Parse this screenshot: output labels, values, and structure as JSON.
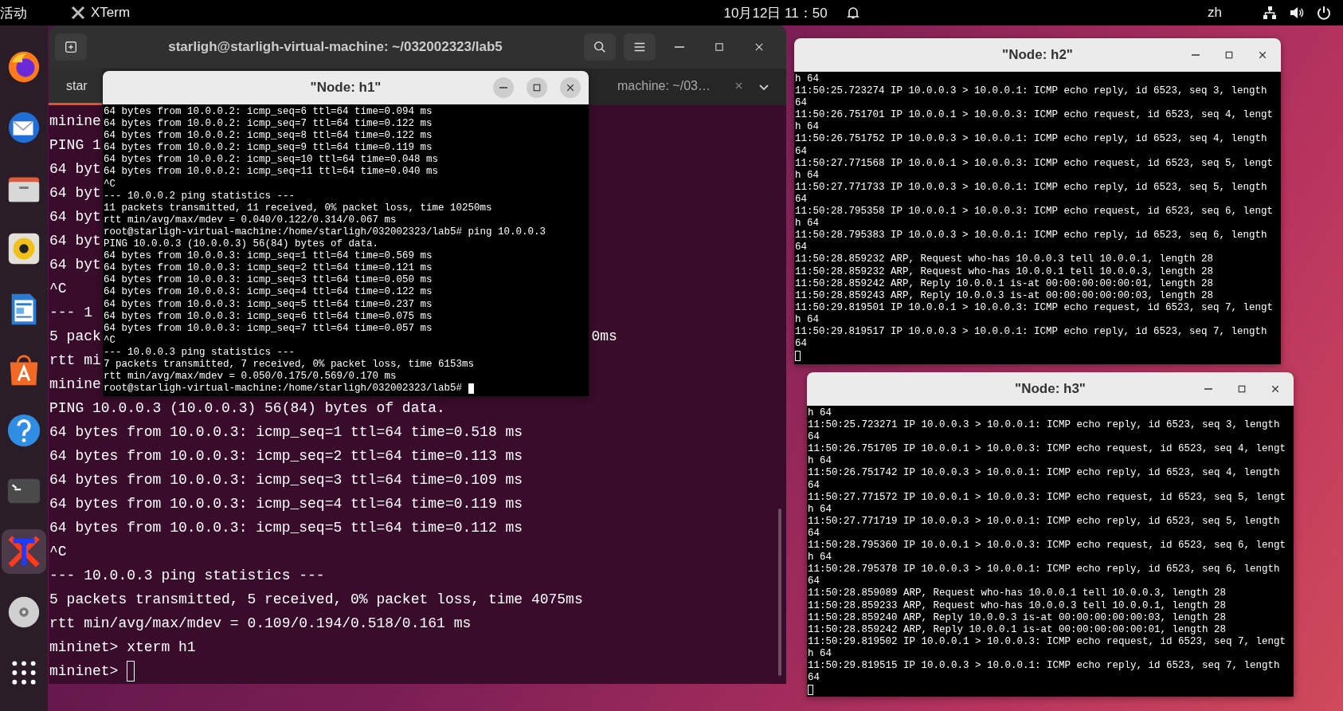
{
  "top_bar": {
    "activities": "活动",
    "app": "XTerm",
    "clock": "10月12日 11：50",
    "language": "zh"
  },
  "dock": [
    {
      "kind": "firefox",
      "selected": false
    },
    {
      "kind": "mail",
      "selected": false
    },
    {
      "kind": "files",
      "selected": false
    },
    {
      "kind": "music",
      "selected": false
    },
    {
      "kind": "writer",
      "selected": false
    },
    {
      "kind": "store",
      "selected": false
    },
    {
      "kind": "help",
      "selected": false
    },
    {
      "kind": "terminal",
      "selected": false
    },
    {
      "kind": "xterm",
      "selected": true
    },
    {
      "kind": "disc",
      "selected": false
    },
    {
      "kind": "grid",
      "selected": false
    }
  ],
  "terminal": {
    "title": "starligh@starligh-virtual-machine: ~/032002323/lab5",
    "tabs": [
      {
        "label": "star",
        "selected": true
      },
      {
        "label": "machine: ~/03…",
        "selected": false
      }
    ],
    "lines": [
      {
        "text": "minine"
      },
      {
        "text": "PING 1"
      },
      {
        "text": "64 byt"
      },
      {
        "text": "64 byt"
      },
      {
        "text": "64 byt"
      },
      {
        "text": "64 byt"
      },
      {
        "text": "64 byt"
      },
      {
        "text": "^C"
      },
      {
        "text": "--- 1"
      },
      {
        "text": "5 pack",
        "tail": "0ms"
      },
      {
        "text": "rtt mi"
      },
      {
        "text": "minine"
      },
      {
        "text": "PING 10.0.0.3 (10.0.0.3) 56(84) bytes of data."
      },
      {
        "text": "64 bytes from 10.0.0.3: icmp_seq=1 ttl=64 time=0.518 ms"
      },
      {
        "text": "64 bytes from 10.0.0.3: icmp_seq=2 ttl=64 time=0.113 ms"
      },
      {
        "text": "64 bytes from 10.0.0.3: icmp_seq=3 ttl=64 time=0.109 ms"
      },
      {
        "text": "64 bytes from 10.0.0.3: icmp_seq=4 ttl=64 time=0.119 ms"
      },
      {
        "text": "64 bytes from 10.0.0.3: icmp_seq=5 ttl=64 time=0.112 ms"
      },
      {
        "text": "^C"
      },
      {
        "text": "--- 10.0.0.3 ping statistics ---"
      },
      {
        "text": "5 packets transmitted, 5 received, 0% packet loss, time 4075ms"
      },
      {
        "text": "rtt min/avg/max/mdev = 0.109/0.194/0.518/0.161 ms"
      },
      {
        "text": "mininet> xterm h1"
      },
      {
        "text": "mininet>",
        "cursor": true
      }
    ]
  },
  "xterm_windows": [
    {
      "title": "\"Node: h1\"",
      "focused": true,
      "lines": [
        {
          "text": "64 bytes from 10.0.0.2: icmp_seq=6 ttl=64 time=0.094 ms"
        },
        {
          "text": "64 bytes from 10.0.0.2: icmp_seq=7 ttl=64 time=0.122 ms"
        },
        {
          "text": "64 bytes from 10.0.0.2: icmp_seq=8 ttl=64 time=0.122 ms"
        },
        {
          "text": "64 bytes from 10.0.0.2: icmp_seq=9 ttl=64 time=0.119 ms"
        },
        {
          "text": "64 bytes from 10.0.0.2: icmp_seq=10 ttl=64 time=0.048 ms"
        },
        {
          "text": "64 bytes from 10.0.0.2: icmp_seq=11 ttl=64 time=0.040 ms"
        },
        {
          "text": "^C"
        },
        {
          "text": "--- 10.0.0.2 ping statistics ---"
        },
        {
          "text": "11 packets transmitted, 11 received, 0% packet loss, time 10250ms"
        },
        {
          "text": "rtt min/avg/max/mdev = 0.040/0.122/0.314/0.067 ms"
        },
        {
          "text": "root@starligh-virtual-machine:/home/starligh/032002323/lab5# ping 10.0.0.3"
        },
        {
          "text": "PING 10.0.0.3 (10.0.0.3) 56(84) bytes of data."
        },
        {
          "text": "64 bytes from 10.0.0.3: icmp_seq=1 ttl=64 time=0.569 ms"
        },
        {
          "text": "64 bytes from 10.0.0.3: icmp_seq=2 ttl=64 time=0.121 ms"
        },
        {
          "text": "64 bytes from 10.0.0.3: icmp_seq=3 ttl=64 time=0.050 ms"
        },
        {
          "text": "64 bytes from 10.0.0.3: icmp_seq=4 ttl=64 time=0.122 ms"
        },
        {
          "text": "64 bytes from 10.0.0.3: icmp_seq=5 ttl=64 time=0.237 ms"
        },
        {
          "text": "64 bytes from 10.0.0.3: icmp_seq=6 ttl=64 time=0.075 ms"
        },
        {
          "text": "64 bytes from 10.0.0.3: icmp_seq=7 ttl=64 time=0.057 ms"
        },
        {
          "text": "^C"
        },
        {
          "text": "--- 10.0.0.3 ping statistics ---"
        },
        {
          "text": "7 packets transmitted, 7 received, 0% packet loss, time 6153ms"
        },
        {
          "text": "rtt min/avg/max/mdev = 0.050/0.175/0.569/0.170 ms"
        },
        {
          "text": "root@starligh-virtual-machine:/home/starligh/032002323/lab5#",
          "cursor": true
        }
      ]
    },
    {
      "title": "\"Node: h2\"",
      "focused": false,
      "lines": [
        {
          "text": "h 64"
        },
        {
          "text": "11:50:25.723274 IP 10.0.0.3 > 10.0.0.1: ICMP echo reply, id 6523, seq 3, length"
        },
        {
          "text": "64"
        },
        {
          "text": "11:50:26.751701 IP 10.0.0.1 > 10.0.0.3: ICMP echo request, id 6523, seq 4, lengt"
        },
        {
          "text": "h 64"
        },
        {
          "text": "11:50:26.751752 IP 10.0.0.3 > 10.0.0.1: ICMP echo reply, id 6523, seq 4, length"
        },
        {
          "text": "64"
        },
        {
          "text": "11:50:27.771568 IP 10.0.0.1 > 10.0.0.3: ICMP echo request, id 6523, seq 5, lengt"
        },
        {
          "text": "h 64"
        },
        {
          "text": "11:50:27.771733 IP 10.0.0.3 > 10.0.0.1: ICMP echo reply, id 6523, seq 5, length"
        },
        {
          "text": "64"
        },
        {
          "text": "11:50:28.795358 IP 10.0.0.1 > 10.0.0.3: ICMP echo request, id 6523, seq 6, lengt"
        },
        {
          "text": "h 64"
        },
        {
          "text": "11:50:28.795383 IP 10.0.0.3 > 10.0.0.1: ICMP echo reply, id 6523, seq 6, length"
        },
        {
          "text": "64"
        },
        {
          "text": "11:50:28.859232 ARP, Request who-has 10.0.0.3 tell 10.0.0.1, length 28"
        },
        {
          "text": "11:50:28.859232 ARP, Request who-has 10.0.0.1 tell 10.0.0.3, length 28"
        },
        {
          "text": "11:50:28.859242 ARP, Reply 10.0.0.1 is-at 00:00:00:00:00:01, length 28"
        },
        {
          "text": "11:50:28.859243 ARP, Reply 10.0.0.3 is-at 00:00:00:00:00:03, length 28"
        },
        {
          "text": "11:50:29.819501 IP 10.0.0.1 > 10.0.0.3: ICMP echo request, id 6523, seq 7, lengt"
        },
        {
          "text": "h 64"
        },
        {
          "text": "11:50:29.819517 IP 10.0.0.3 > 10.0.0.1: ICMP echo reply, id 6523, seq 7, length"
        },
        {
          "text": "64"
        },
        {
          "cursor": true
        }
      ]
    },
    {
      "title": "\"Node: h3\"",
      "focused": false,
      "lines": [
        {
          "text": "h 64"
        },
        {
          "text": "11:50:25.723271 IP 10.0.0.3 > 10.0.0.1: ICMP echo reply, id 6523, seq 3, length"
        },
        {
          "text": "64"
        },
        {
          "text": "11:50:26.751705 IP 10.0.0.1 > 10.0.0.3: ICMP echo request, id 6523, seq 4, lengt"
        },
        {
          "text": "h 64"
        },
        {
          "text": "11:50:26.751742 IP 10.0.0.3 > 10.0.0.1: ICMP echo reply, id 6523, seq 4, length"
        },
        {
          "text": "64"
        },
        {
          "text": "11:50:27.771572 IP 10.0.0.1 > 10.0.0.3: ICMP echo request, id 6523, seq 5, lengt"
        },
        {
          "text": "h 64"
        },
        {
          "text": "11:50:27.771719 IP 10.0.0.3 > 10.0.0.1: ICMP echo reply, id 6523, seq 5, length"
        },
        {
          "text": "64"
        },
        {
          "text": "11:50:28.795360 IP 10.0.0.1 > 10.0.0.3: ICMP echo request, id 6523, seq 6, lengt"
        },
        {
          "text": "h 64"
        },
        {
          "text": "11:50:28.795378 IP 10.0.0.3 > 10.0.0.1: ICMP echo reply, id 6523, seq 6, length"
        },
        {
          "text": "64"
        },
        {
          "text": "11:50:28.859089 ARP, Request who-has 10.0.0.1 tell 10.0.0.3, length 28"
        },
        {
          "text": "11:50:28.859233 ARP, Request who-has 10.0.0.3 tell 10.0.0.1, length 28"
        },
        {
          "text": "11:50:28.859240 ARP, Reply 10.0.0.3 is-at 00:00:00:00:00:03, length 28"
        },
        {
          "text": "11:50:28.859242 ARP, Reply 10.0.0.1 is-at 00:00:00:00:00:01, length 28"
        },
        {
          "text": "11:50:29.819502 IP 10.0.0.1 > 10.0.0.3: ICMP echo request, id 6523, seq 7, lengt"
        },
        {
          "text": "h 64"
        },
        {
          "text": "11:50:29.819515 IP 10.0.0.3 > 10.0.0.1: ICMP echo reply, id 6523, seq 7, length"
        },
        {
          "text": "64"
        },
        {
          "cursor": true
        }
      ]
    }
  ]
}
